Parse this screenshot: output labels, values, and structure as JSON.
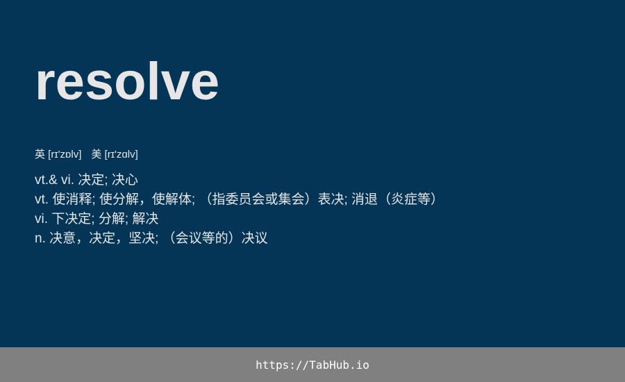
{
  "word": "resolve",
  "phonetics": {
    "uk": "英 [rɪ'zɒlv]",
    "us": "美 [rɪ'zɑlv]"
  },
  "definitions": [
    "vt.& vi. 决定; 决心",
    "vt. 使消释; 使分解，使解体; （指委员会或集会）表决; 消退（炎症等）",
    "vi. 下决定; 分解; 解决",
    "n. 决意，决定，坚决; （会议等的）决议"
  ],
  "footer": {
    "link_text": "https://TabHub.io"
  },
  "colors": {
    "background": "#043557",
    "text": "#e6e6e6",
    "footer_background": "#808080",
    "footer_text": "#ffffff"
  }
}
